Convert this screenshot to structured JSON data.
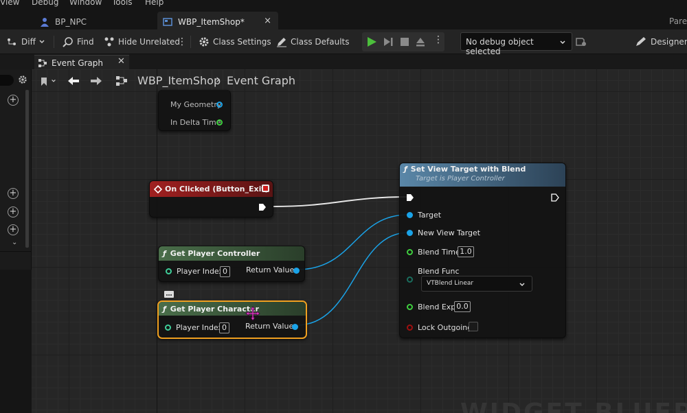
{
  "menu": {
    "items": [
      "View",
      "Debug",
      "Window",
      "Tools",
      "Help"
    ]
  },
  "tabs": {
    "npc": "BP_NPC",
    "item_shop": "WBP_ItemShop*",
    "close": "×",
    "parent_label": "Pare"
  },
  "toolbar": {
    "diff": "Diff",
    "find": "Find",
    "hide_unrelated": "Hide Unrelated",
    "class_settings": "Class Settings",
    "class_defaults": "Class Defaults",
    "debug_object": "No debug object selected",
    "designer": "Designer"
  },
  "graph_tab": {
    "label": "Event Graph"
  },
  "breadcrumb": {
    "blueprint": "WBP_ItemShop",
    "graph": "Event Graph"
  },
  "nodes": {
    "tick": {
      "my_geometry": "My Geometry",
      "in_delta_time": "In Delta Time"
    },
    "on_clicked": {
      "title": "On Clicked (Button_Exit)"
    },
    "get_player_controller": {
      "title": "Get Player Controller",
      "player_index_label": "Player Index",
      "player_index_value": "0",
      "return_value": "Return Value"
    },
    "get_player_character": {
      "title": "Get Player Character",
      "player_index_label": "Player Index",
      "player_index_value": "0",
      "return_value": "Return Value"
    },
    "set_view_target": {
      "title": "Set View Target with Blend",
      "subtitle": "Target is Player Controller",
      "target": "Target",
      "new_view_target": "New View Target",
      "blend_time_label": "Blend Time",
      "blend_time_value": "1.0",
      "blend_func_label": "Blend Func",
      "blend_func_value": "VTBlend Linear",
      "blend_exp_label": "Blend Exp",
      "blend_exp_value": "0.0",
      "lock_outgoing_label": "Lock Outgoing"
    }
  },
  "watermark": "WIDGET BLUEPR",
  "colors": {
    "object_pin": "#1aa3e8",
    "float_pin": "#3fcf3f",
    "bool_pin": "#a01010",
    "event_header": "#8b1b1b",
    "pure_header": "#3c5a3c",
    "function_header": "#4a6f8c",
    "selection": "#f0a020"
  }
}
